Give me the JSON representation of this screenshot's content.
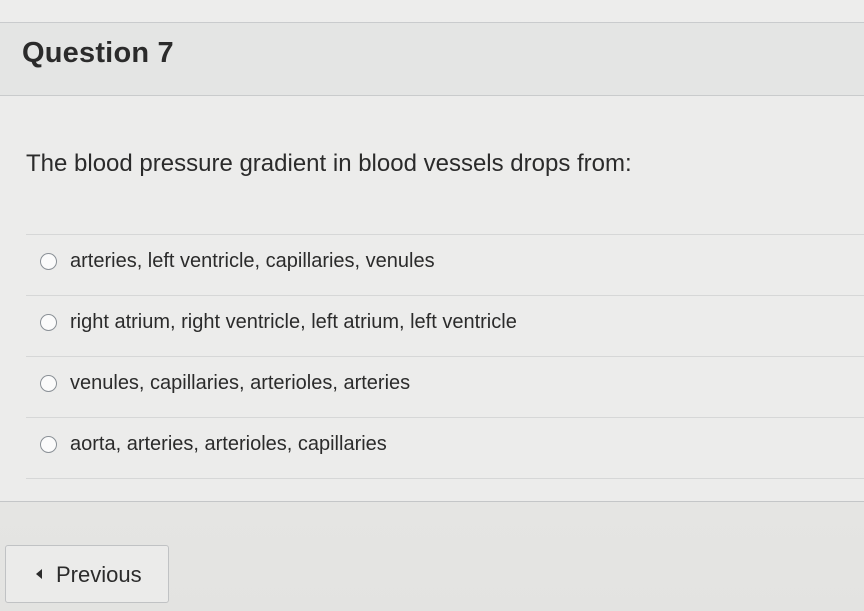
{
  "question": {
    "title": "Question 7",
    "text": "The blood pressure gradient in blood vessels drops from:",
    "answers": [
      {
        "label": "arteries, left ventricle, capillaries, venules"
      },
      {
        "label": "right atrium, right ventricle, left atrium, left ventricle"
      },
      {
        "label": "venules, capillaries, arterioles, arteries"
      },
      {
        "label": "aorta, arteries, arterioles, capillaries"
      }
    ]
  },
  "navigation": {
    "previous_label": "Previous"
  }
}
